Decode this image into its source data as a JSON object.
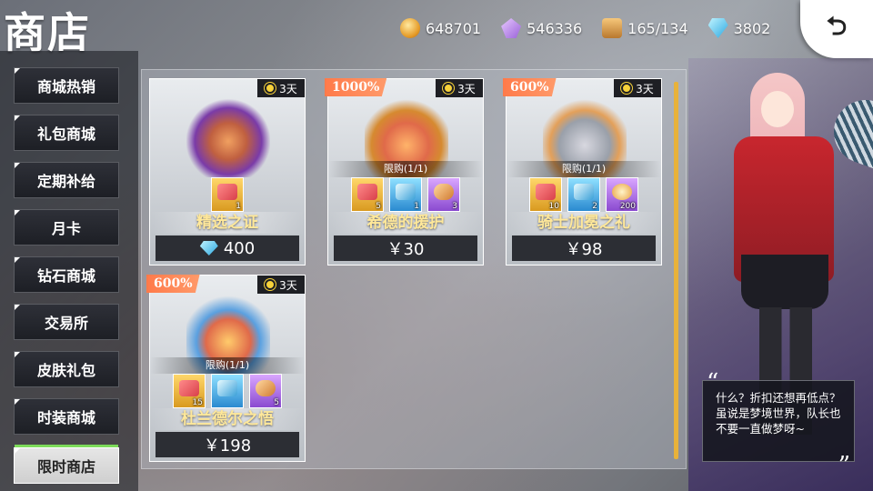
{
  "header": {
    "title": "商店"
  },
  "resources": [
    {
      "icon": "gold-coin-icon",
      "value": "648701"
    },
    {
      "icon": "crystal-icon",
      "value": "546336"
    },
    {
      "icon": "supply-box-icon",
      "value": "165/134"
    },
    {
      "icon": "diamond-icon",
      "value": "3802"
    }
  ],
  "back_button": {
    "icon": "back-arrow-icon",
    "glyph": "⮌"
  },
  "sidebar": {
    "items": [
      {
        "label": "商城热销",
        "active": false
      },
      {
        "label": "礼包商城",
        "active": false
      },
      {
        "label": "定期补给",
        "active": false
      },
      {
        "label": "月卡",
        "active": false
      },
      {
        "label": "钻石商城",
        "active": false
      },
      {
        "label": "交易所",
        "active": false
      },
      {
        "label": "皮肤礼包",
        "active": false
      },
      {
        "label": "时装商城",
        "active": false
      },
      {
        "label": "限时商店",
        "active": true
      }
    ]
  },
  "cards": [
    {
      "name": "精选之证",
      "timer": "3天",
      "discount": "",
      "limit": "",
      "price": "400",
      "price_icon": "diamond-icon",
      "items": [
        {
          "count": "1",
          "color": "gold",
          "glyph": "ticket"
        }
      ]
    },
    {
      "name": "希德的援护",
      "timer": "3天",
      "discount": "1000%",
      "limit": "限购(1/1)",
      "price": "￥30",
      "price_icon": "",
      "items": [
        {
          "count": "5",
          "color": "gold",
          "glyph": "ticket"
        },
        {
          "count": "1",
          "color": "blue",
          "glyph": "card"
        },
        {
          "count": "3",
          "color": "purple",
          "glyph": "bread"
        }
      ]
    },
    {
      "name": "骑士加冕之礼",
      "timer": "3天",
      "discount": "600%",
      "limit": "限购(1/1)",
      "price": "￥98",
      "price_icon": "",
      "items": [
        {
          "count": "10",
          "color": "gold",
          "glyph": "ticket"
        },
        {
          "count": "2",
          "color": "blue",
          "glyph": "card"
        },
        {
          "count": "200",
          "color": "purple",
          "glyph": "meal"
        }
      ]
    },
    {
      "name": "杜兰德尔之悟",
      "timer": "3天",
      "discount": "600%",
      "limit": "限购(1/1)",
      "price": "￥198",
      "price_icon": "",
      "items": [
        {
          "count": "15",
          "color": "gold",
          "glyph": "ticket"
        },
        {
          "count": "",
          "color": "blue",
          "glyph": "card"
        },
        {
          "count": "5",
          "color": "purple",
          "glyph": "bread"
        }
      ]
    }
  ],
  "speech": {
    "text": "什么？折扣还想再低点？虽说是梦境世界，队长也不要一直做梦呀~",
    "quote_open": "“",
    "quote_close": "”"
  }
}
